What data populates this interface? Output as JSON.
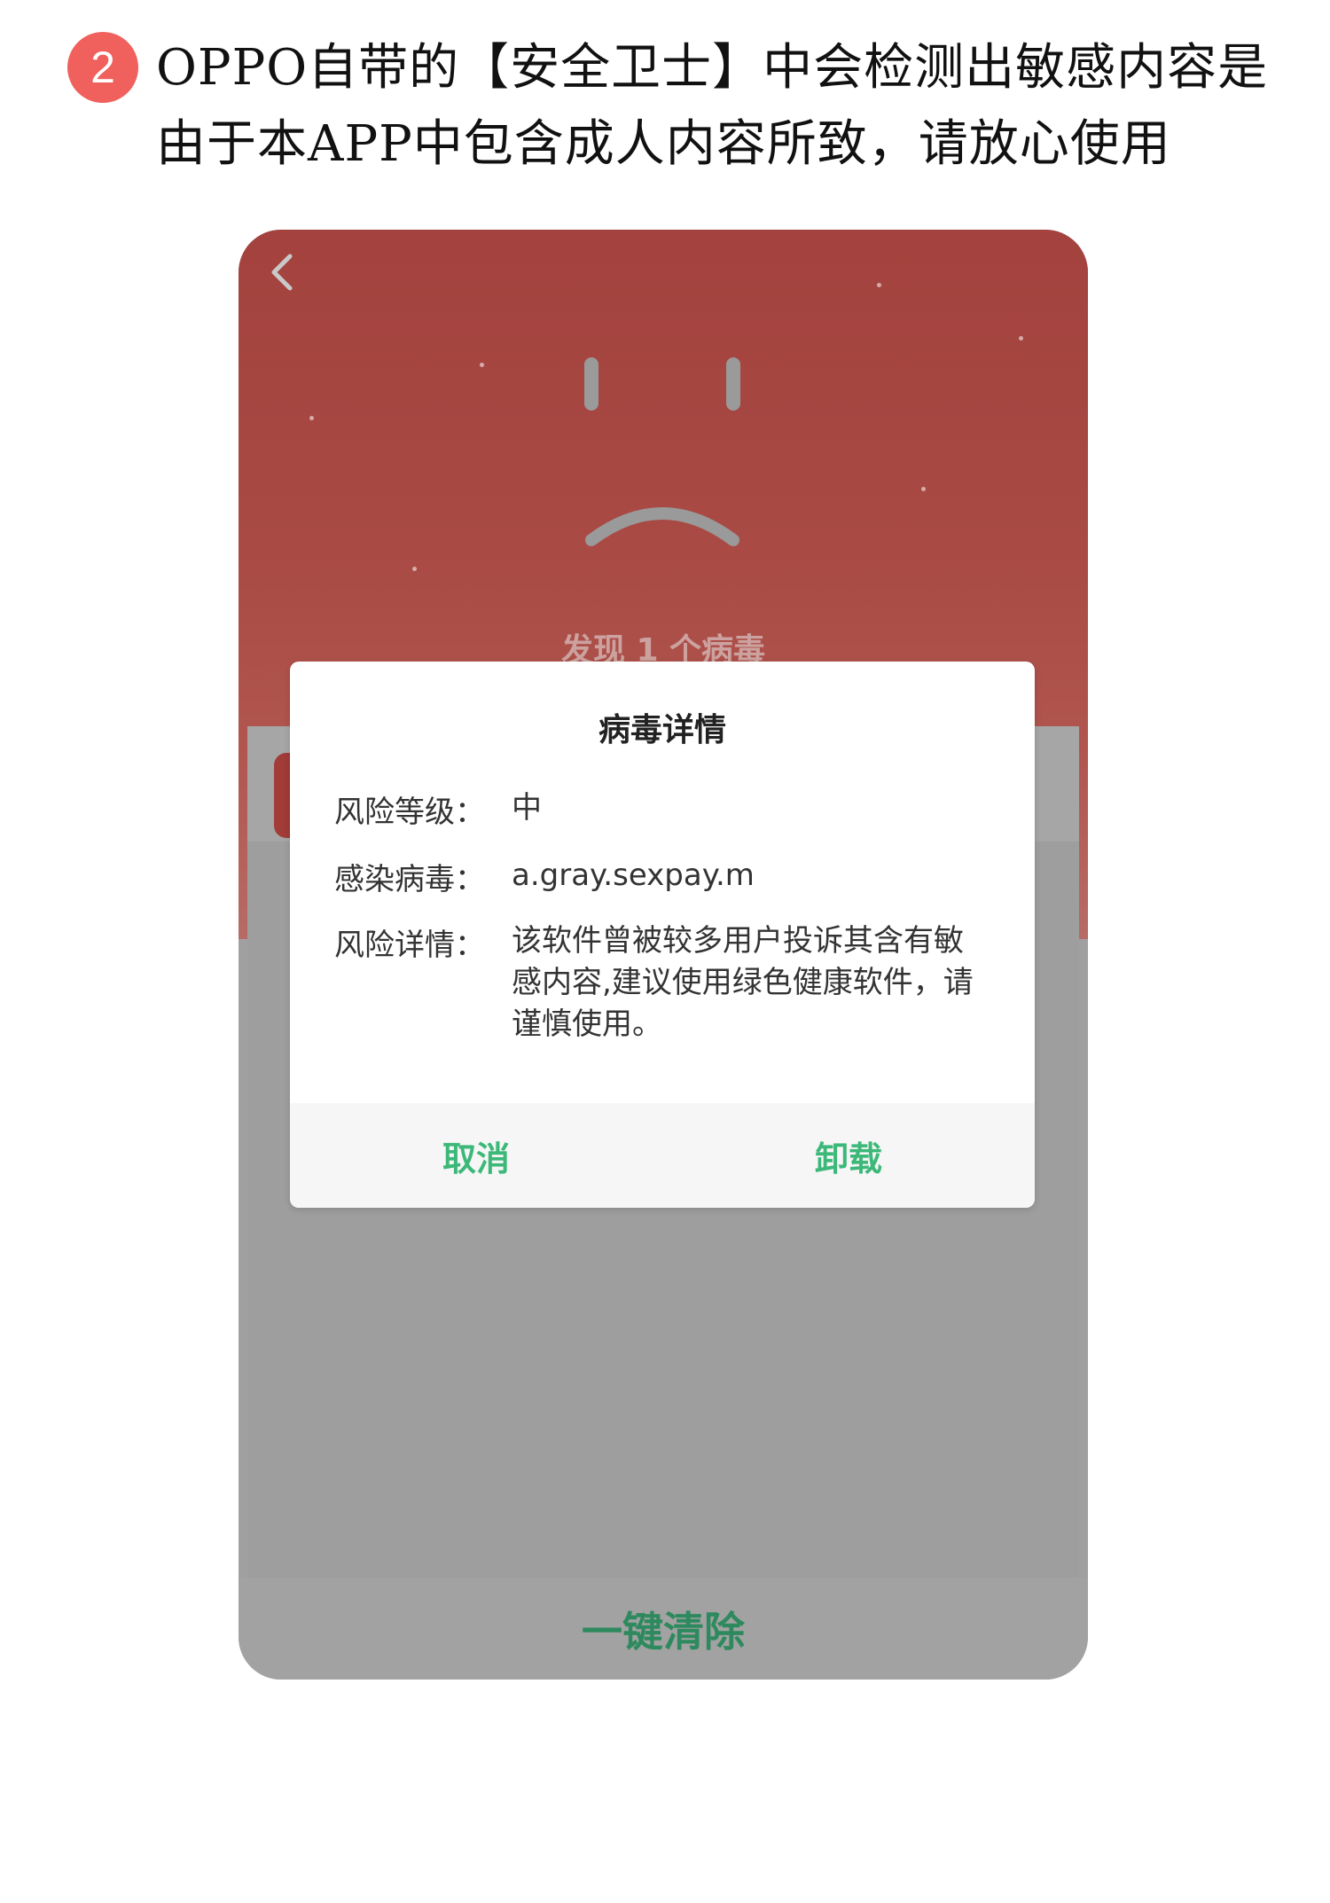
{
  "instruction": {
    "step_number": "2",
    "headline": "OPPO自带的【安全卫士】中会检测出敏感内容是由于本APP中包含成人内容所致，请放心使用"
  },
  "screen": {
    "found_text": "发现 1 个病毒",
    "bottom_button": "一键清除"
  },
  "dialog": {
    "title": "病毒详情",
    "rows": [
      {
        "label": "风险等级：",
        "value": "中"
      },
      {
        "label": "感染病毒：",
        "value": "a.gray.sexpay.m"
      },
      {
        "label": "风险详情：",
        "value": "该软件曾被较多用户投诉其含有敏感内容,建议使用绿色健康软件，请谨慎使用。"
      }
    ],
    "cancel_label": "取消",
    "uninstall_label": "卸载"
  },
  "colors": {
    "badge": "#f0605c",
    "hero_red": "#a3423e",
    "accent_green": "#3cb879",
    "overlay_gray": "#a0a0a0"
  },
  "icons": [
    "back-arrow-icon",
    "sad-face-icon"
  ]
}
